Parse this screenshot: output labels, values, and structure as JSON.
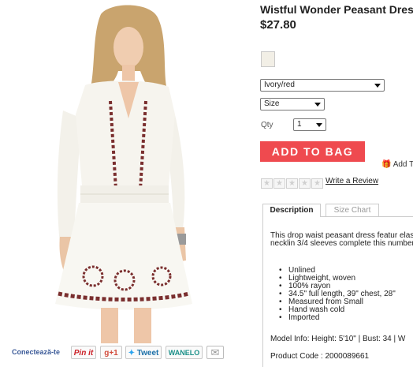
{
  "product": {
    "title": "Wistful Wonder Peasant Dress",
    "price": "$27.80",
    "swatch_color": "#f2efe6"
  },
  "options": {
    "color_value": "Ivory/red",
    "size_value": "Size",
    "qty_label": "Qty",
    "qty_value": "1"
  },
  "actions": {
    "add_to_bag": "ADD TO BAG",
    "gift_label": "Add T",
    "write_review": "Write a Review"
  },
  "rating": {
    "filled": 0,
    "max": 5
  },
  "tabs": [
    {
      "label": "Description",
      "active": true
    },
    {
      "label": "Size Chart",
      "active": false
    }
  ],
  "description": {
    "text": "This drop waist peasant dress featur elasticized waist. A split round necklin 3/4 sleeves complete this number.",
    "bullets": [
      "Unlined",
      "Lightweight, woven",
      "100% rayon",
      "34.5\" full length, 39\" chest, 28\"",
      "Measured from Small",
      "Hand wash cold",
      "Imported"
    ],
    "model_info": "Model Info: Height: 5'10\" | Bust: 34 | W",
    "product_code": "Product Code : 2000089661"
  },
  "share": {
    "label": "Conectează-te",
    "pinit": "Pin it",
    "gplus": "g+1",
    "tweet": "Tweet",
    "wanelo": "WANELO"
  },
  "colors": {
    "accent": "#ef4a4f",
    "link": "#3b5a98"
  }
}
